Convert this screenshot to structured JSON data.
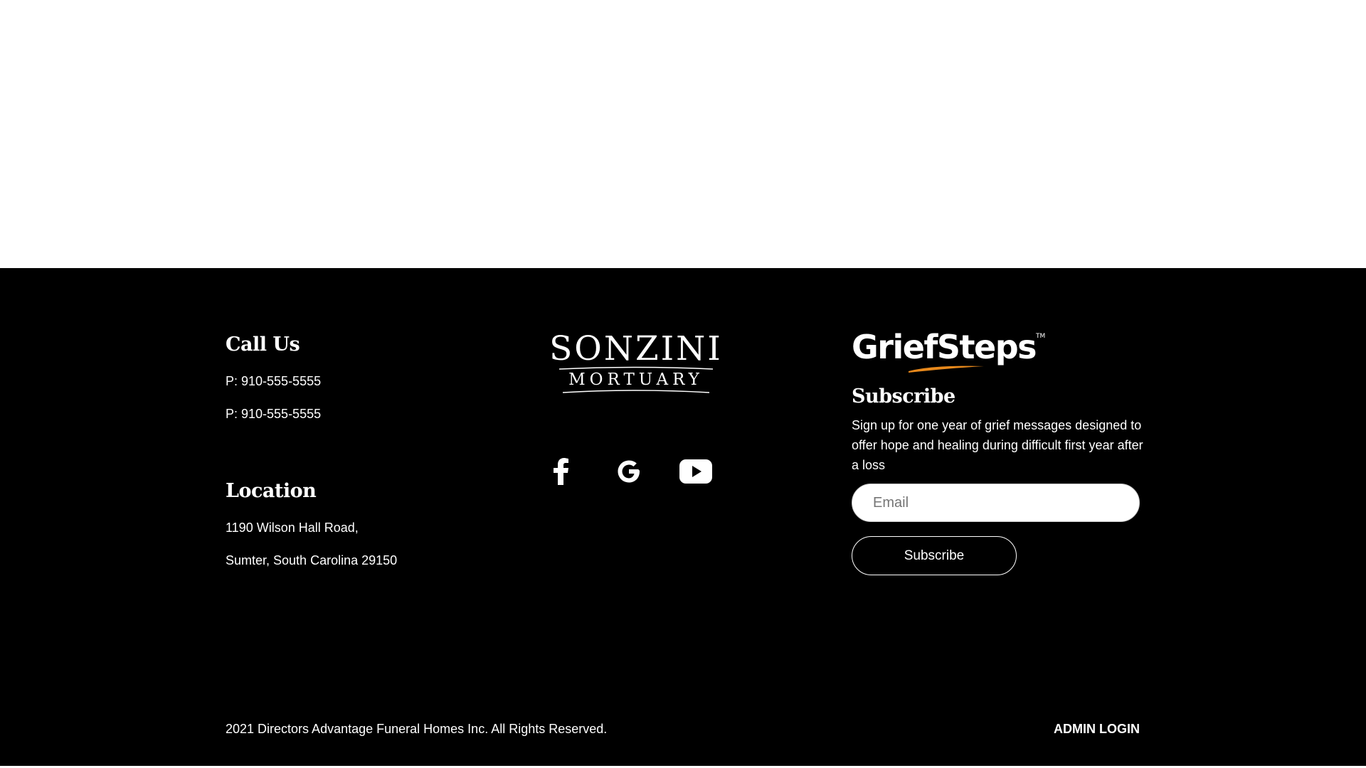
{
  "call_us": {
    "heading": "Call Us",
    "phones": [
      "P: 910-555-5555",
      "P: 910-555-5555"
    ]
  },
  "location": {
    "heading": "Location",
    "address_line1": "1190 Wilson Hall Road,",
    "address_line2": "Sumter, South Carolina 29150"
  },
  "brand": {
    "name": "SONZINI",
    "subtitle": "MORTUARY"
  },
  "social": [
    {
      "name": "facebook",
      "icon": "facebook-icon"
    },
    {
      "name": "google",
      "icon": "google-icon"
    },
    {
      "name": "youtube",
      "icon": "youtube-icon"
    }
  ],
  "griefsteps": {
    "logo_text": "GriefSteps",
    "trademark": "TM",
    "heading": "Subscribe",
    "description": "Sign up for one year of grief messages designed to offer hope and healing during difficult first year after a loss",
    "email_placeholder": "Email",
    "email_value": "",
    "button_label": "Subscribe"
  },
  "footer_bottom": {
    "copyright": "2021 Directors Advantage Funeral Homes Inc. All Rights Reserved.",
    "admin_login": "ADMIN LOGIN"
  },
  "colors": {
    "footer_bg": "#000000",
    "page_bg": "#ffffff",
    "text": "#ffffff",
    "accent_swoosh": "#e8891c"
  }
}
